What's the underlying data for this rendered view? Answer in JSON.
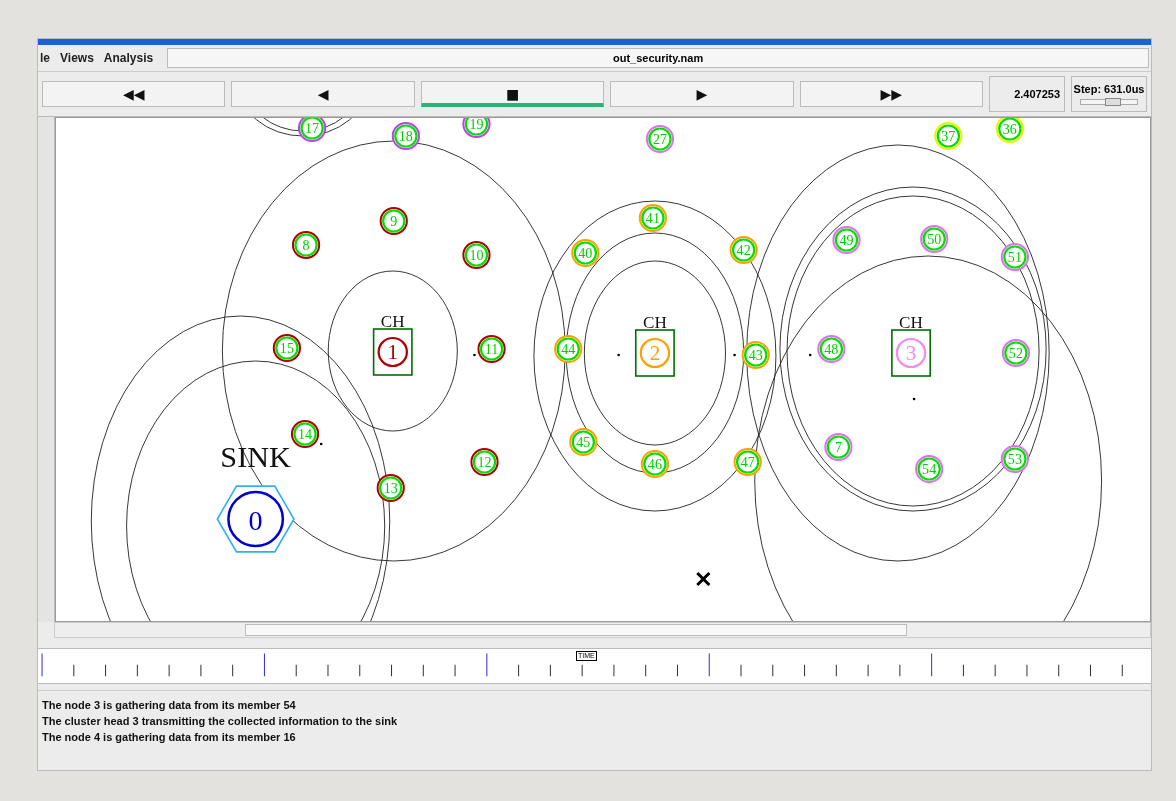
{
  "menu": [
    {
      "label": "le"
    },
    {
      "label": "Views"
    },
    {
      "label": "Analysis"
    }
  ],
  "file_title": "out_security.nam",
  "controls": [
    {
      "label": "◀◀",
      "selected": false
    },
    {
      "label": "◀",
      "selected": false
    },
    {
      "label": "■",
      "selected": true
    },
    {
      "label": "▶",
      "selected": false
    },
    {
      "label": "▶▶",
      "selected": false
    }
  ],
  "time": "2.407253",
  "step": "Step: 631.0us",
  "step_slider": {
    "level": 0.55
  },
  "network": {
    "sink": {
      "label": "SINK",
      "node": "0"
    },
    "cluster_heads": [
      {
        "label": "CH",
        "node": "1",
        "color": "#b00000"
      },
      {
        "label": "CH",
        "node": "2",
        "color": "#ffa000"
      },
      {
        "label": "CH",
        "node": "3",
        "color": "#f08cf0"
      }
    ],
    "nodes": [
      {
        "label": "17",
        "color": "#c040f0"
      },
      {
        "label": "18",
        "color": "#c040f0"
      },
      {
        "label": "19",
        "color": "#c040f0"
      },
      {
        "label": "27",
        "color": "#e070f0"
      },
      {
        "label": "37",
        "color": "#f0f000"
      },
      {
        "label": "36",
        "color": "#f0f000"
      },
      {
        "label": "9",
        "color": "#b00000"
      },
      {
        "label": "8",
        "color": "#b00000"
      },
      {
        "label": "10",
        "color": "#b00000"
      },
      {
        "label": "41",
        "color": "#ffa000"
      },
      {
        "label": "40",
        "color": "#ffa000"
      },
      {
        "label": "42",
        "color": "#ffa000"
      },
      {
        "label": "49",
        "color": "#e070f0"
      },
      {
        "label": "50",
        "color": "#e070f0"
      },
      {
        "label": "51",
        "color": "#e070f0"
      },
      {
        "label": "15",
        "color": "#b00000"
      },
      {
        "label": "11",
        "color": "#b00000"
      },
      {
        "label": "44",
        "color": "#ffa000"
      },
      {
        "label": "43",
        "color": "#ffa000"
      },
      {
        "label": "48",
        "color": "#e070f0"
      },
      {
        "label": "52",
        "color": "#e070f0"
      },
      {
        "label": "14",
        "color": "#b00000"
      },
      {
        "label": "12",
        "color": "#b00000"
      },
      {
        "label": "13",
        "color": "#b00000"
      },
      {
        "label": "45",
        "color": "#ffa000"
      },
      {
        "label": "46",
        "color": "#ffa000"
      },
      {
        "label": "47",
        "color": "#ffa000"
      },
      {
        "label": "7",
        "color": "#e070f0"
      },
      {
        "label": "54",
        "color": "#e070f0"
      },
      {
        "label": "53",
        "color": "#e070f0"
      }
    ]
  },
  "timeline": {
    "marker": "TIME"
  },
  "messages": [
    "The node 3 is gathering data from its member 54",
    "The cluster head 3 transmitting the collected information to the sink",
    "The node 4 is gathering data from its member 16"
  ]
}
